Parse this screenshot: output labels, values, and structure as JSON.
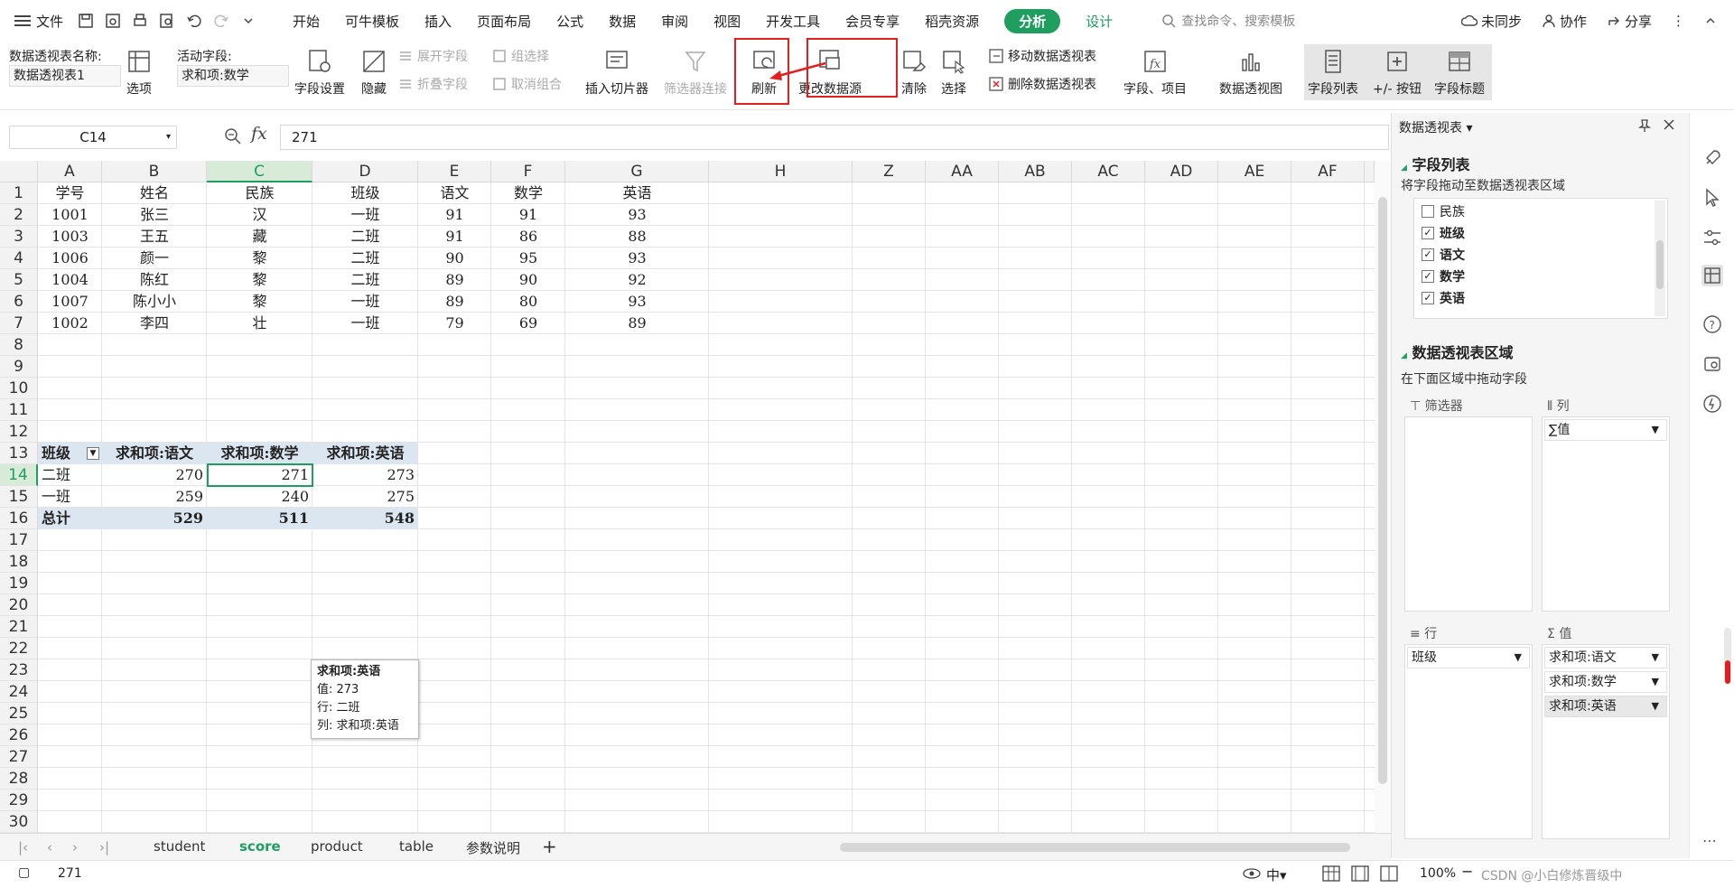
{
  "menubar": {
    "file_label": "文件",
    "tabs": [
      "开始",
      "可牛模板",
      "插入",
      "页面布局",
      "公式",
      "数据",
      "审阅",
      "视图",
      "开发工具",
      "会员专享",
      "稻壳资源"
    ],
    "active_tab": "分析",
    "design_tab": "设计",
    "search_placeholder": "查找命令、搜索模板",
    "unsync": "未同步",
    "collab": "协作",
    "share": "分享"
  },
  "ribbon": {
    "pivot_name_label": "数据透视表名称:",
    "pivot_name_value": "数据透视表1",
    "options_label": "选项",
    "active_field_label": "活动字段:",
    "active_field_value": "求和项:数学",
    "field_settings": "字段设置",
    "hide": "隐藏",
    "expand_field": "展开字段",
    "collapse_field": "折叠字段",
    "group_selection": "组选择",
    "ungroup": "取消组合",
    "insert_slicer": "插入切片器",
    "filter_connection": "筛选器连接",
    "refresh": "刷新",
    "change_source": "更改数据源",
    "clear": "清除",
    "select": "选择",
    "move_pivot": "移动数据透视表",
    "delete_pivot": "删除数据透视表",
    "fields_items": "字段、项目",
    "pivot_chart": "数据透视图",
    "field_list": "字段列表",
    "plus_minus": "+/- 按钮",
    "field_headers": "字段标题"
  },
  "formula": {
    "cell_ref": "C14",
    "fx": "fx",
    "value": "271"
  },
  "grid": {
    "columns": [
      "A",
      "B",
      "C",
      "D",
      "E",
      "F",
      "G",
      "H",
      "Z",
      "AA",
      "AB",
      "AC",
      "AD",
      "AE",
      "AF"
    ],
    "rows": [
      "1",
      "2",
      "3",
      "4",
      "5",
      "6",
      "7",
      "8",
      "9",
      "10",
      "11",
      "12",
      "13",
      "14",
      "15",
      "16",
      "17",
      "18",
      "19",
      "20",
      "21",
      "22",
      "23",
      "24",
      "25",
      "26",
      "27",
      "28",
      "29",
      "30"
    ],
    "table_header": [
      "学号",
      "姓名",
      "民族",
      "班级",
      "语文",
      "数学",
      "英语"
    ],
    "table_rows": [
      [
        "1001",
        "张三",
        "汉",
        "一班",
        "91",
        "91",
        "93"
      ],
      [
        "1003",
        "王五",
        "藏",
        "二班",
        "91",
        "86",
        "88"
      ],
      [
        "1006",
        "颜一",
        "黎",
        "二班",
        "90",
        "95",
        "93"
      ],
      [
        "1004",
        "陈红",
        "黎",
        "二班",
        "89",
        "90",
        "92"
      ],
      [
        "1007",
        "陈小小",
        "黎",
        "一班",
        "89",
        "80",
        "93"
      ],
      [
        "1002",
        "李四",
        "壮",
        "一班",
        "79",
        "69",
        "89"
      ]
    ],
    "pivot_header": [
      "班级",
      "求和项:语文",
      "求和项:数学",
      "求和项:英语"
    ],
    "pivot_rows": [
      [
        "二班",
        "270",
        "271",
        "273"
      ],
      [
        "一班",
        "259",
        "240",
        "275"
      ]
    ],
    "pivot_total": [
      "总计",
      "529",
      "511",
      "548"
    ]
  },
  "tooltip": {
    "title": "求和项:英语",
    "value_line": "值: 273",
    "row_line": "行: 二班",
    "col_line": "列: 求和项:英语"
  },
  "sheets": {
    "tabs": [
      "student",
      "score",
      "product",
      "table",
      "参数说明"
    ],
    "active": "score"
  },
  "status": {
    "value": "271",
    "zoom": "100%",
    "watermark": "CSDN @小白修炼晋级中"
  },
  "panel": {
    "title": "数据透视表",
    "field_list_title": "字段列表",
    "drag_hint": "将字段拖动至数据透视表区域",
    "fields": [
      {
        "name": "民族",
        "checked": false
      },
      {
        "name": "班级",
        "checked": true
      },
      {
        "name": "语文",
        "checked": true
      },
      {
        "name": "数学",
        "checked": true
      },
      {
        "name": "英语",
        "checked": true
      }
    ],
    "areas_title": "数据透视表区域",
    "areas_hint": "在下面区域中拖动字段",
    "filter_label": "筛选器",
    "columns_label": "列",
    "columns_item": "∑值",
    "rows_label": "行",
    "rows_item": "班级",
    "values_label": "值",
    "values_items": [
      "求和项:语文",
      "求和项:数学",
      "求和项:英语"
    ]
  },
  "colors": {
    "accent_green": "#1f9e60",
    "highlight_red": "#e02020",
    "pivot_fill": "#dce6f1"
  }
}
